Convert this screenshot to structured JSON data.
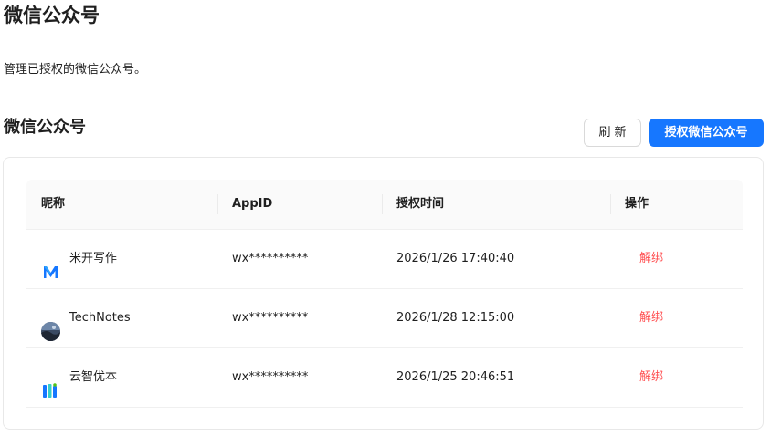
{
  "page": {
    "title": "微信公众号",
    "description": "管理已授权的微信公众号。"
  },
  "section": {
    "title": "微信公众号",
    "refresh_label": "刷新",
    "authorize_label": "授权微信公众号"
  },
  "table": {
    "columns": [
      "昵称",
      "AppID",
      "授权时间",
      "操作"
    ],
    "rows": [
      {
        "nickname": "米开写作",
        "avatar_icon": "m-logo-icon",
        "appid": "wx**********",
        "auth_time": "2026/1/26 17:40:40",
        "action": "解绑"
      },
      {
        "nickname": "TechNotes",
        "avatar_icon": "photo-avatar-icon",
        "appid": "wx**********",
        "auth_time": "2026/1/28 12:15:00",
        "action": "解绑"
      },
      {
        "nickname": "云智优本",
        "avatar_icon": "book-logo-icon",
        "appid": "wx**********",
        "auth_time": "2026/1/25 20:46:51",
        "action": "解绑"
      }
    ]
  },
  "colors": {
    "primary": "#1677ff",
    "danger": "#ff4d4f"
  }
}
